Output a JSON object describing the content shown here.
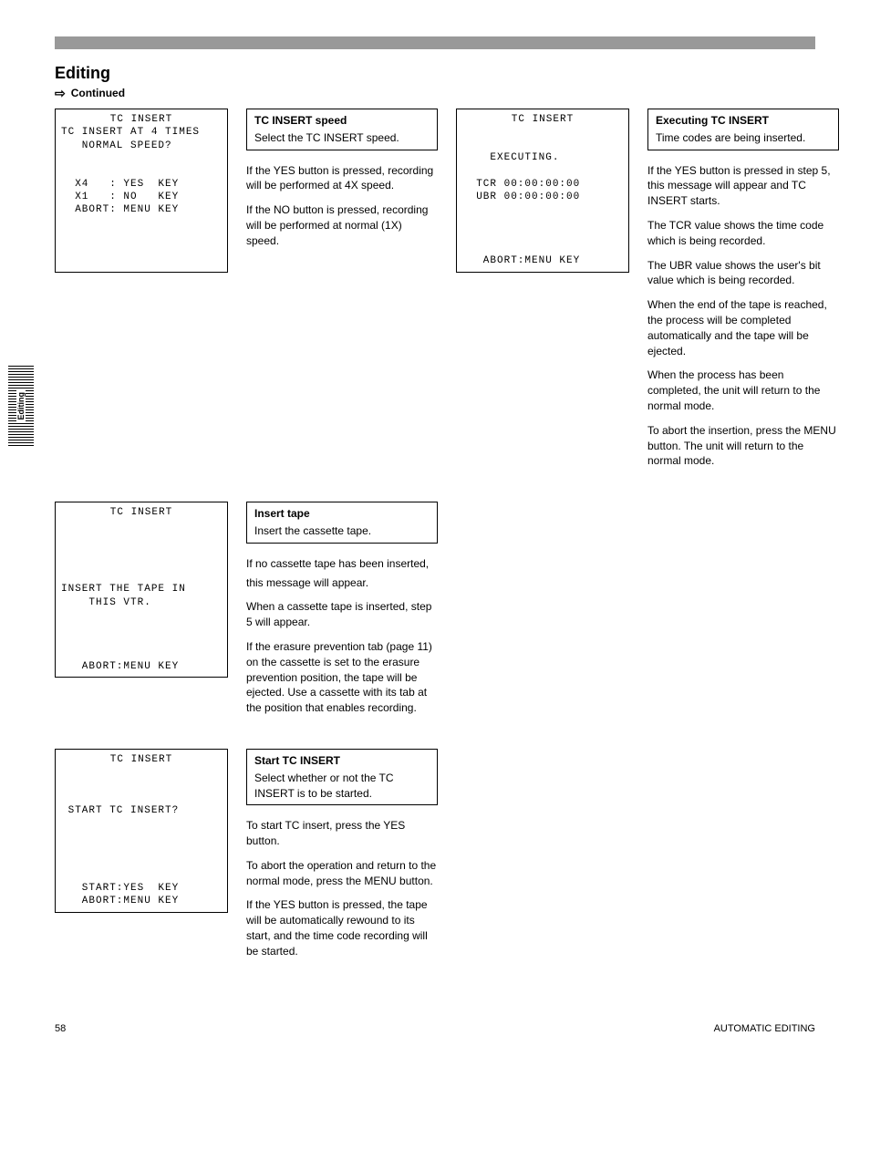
{
  "topbar": {},
  "sideTab": {
    "label": "Editing"
  },
  "main": {
    "heading": "Editing",
    "subLabel": "Continued",
    "row1": {
      "screenA": {
        "title": "TC INSERT",
        "l1": "TC INSERT AT 4 TIMES",
        "l2": "   NORMAL SPEED?",
        "l3": "  X4   : YES  KEY",
        "l4": "  X1   : NO   KEY",
        "l5": "  ABORT: MENU KEY"
      },
      "boxA": {
        "bold": "TC INSERT speed",
        "body": "Select the TC INSERT speed."
      },
      "descA": {
        "p1": "If the YES button is pressed, recording will be performed at 4X speed.",
        "p2": "If the NO button is pressed, recording will be performed at normal (1X) speed."
      },
      "screenB": {
        "title": "TC INSERT",
        "l1": "    EXECUTING.",
        "l2": "  TCR 00:00:00:00",
        "l3": "  UBR 00:00:00:00",
        "l4": "   ABORT:MENU KEY"
      },
      "boxB": {
        "bold": "Executing TC INSERT",
        "body": "Time codes are being inserted."
      },
      "descB": {
        "p1": "If the YES button is pressed in step 5, this message will appear and TC INSERT starts.",
        "p2": "The TCR value shows the time code which is being recorded.",
        "p3": "The UBR value shows the user's bit value which is being recorded.",
        "p4": "When the end of the tape is reached, the process will be completed automatically and the tape will be ejected.",
        "p5": "When the process has been completed, the unit will return to the normal mode.",
        "p6": "To abort the insertion, press the MENU button. The unit will return to the normal mode."
      }
    },
    "row2": {
      "screenA": {
        "title": "TC INSERT",
        "l1": "INSERT THE TAPE IN",
        "l2": "    THIS VTR.",
        "l3": "   ABORT:MENU KEY"
      },
      "boxA": {
        "bold": "Insert tape",
        "body": "Insert the cassette tape."
      },
      "descA": {
        "p1": "If no cassette tape has been inserted,",
        "p2t": "this message will appear.",
        "p3": "When a cassette tape is inserted, step 5 will appear.",
        "p4": "If the erasure prevention tab (page 11) on the cassette is set to the erasure prevention position, the tape will be ejected. Use a cassette with its tab at the position that enables recording."
      }
    },
    "row3": {
      "screenA": {
        "title": "TC INSERT",
        "l1": " START TC INSERT?",
        "l2": "   START:YES  KEY",
        "l3": "   ABORT:MENU KEY"
      },
      "boxA": {
        "bold": "Start TC INSERT",
        "body": "Select whether or not the TC INSERT is to be started."
      },
      "descA": {
        "p1": "To start TC insert, press the YES button.",
        "p2": "To abort the operation and return to the normal mode, press the MENU button.",
        "p3": "If the YES button is pressed, the tape will be automatically rewound to its start, and the time code recording will be started."
      }
    }
  },
  "footer": {
    "page": "58",
    "label": "AUTOMATIC EDITING"
  }
}
